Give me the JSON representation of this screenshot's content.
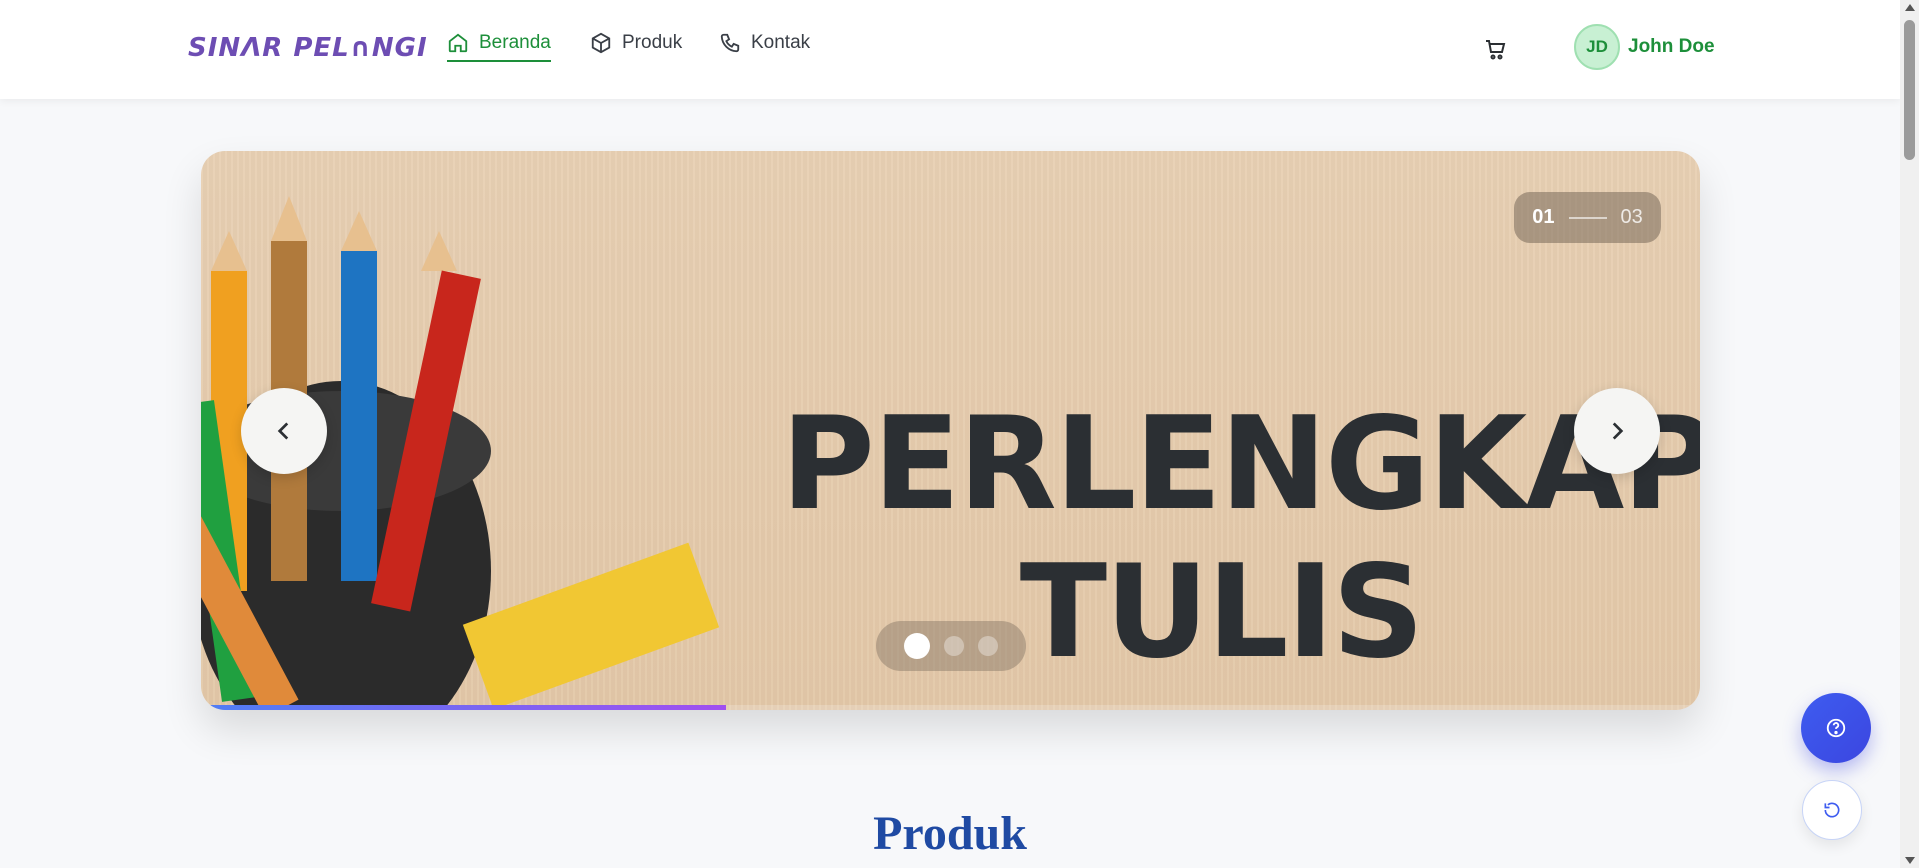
{
  "header": {
    "logo_text": "SINΛR PEL∩NGI",
    "nav": [
      {
        "label": "Beranda",
        "icon": "home-icon",
        "active": true
      },
      {
        "label": "Produk",
        "icon": "box-icon",
        "active": false
      },
      {
        "label": "Kontak",
        "icon": "phone-icon",
        "active": false
      }
    ],
    "cart_icon": "cart-icon",
    "user": {
      "initials": "JD",
      "name": "John Doe"
    }
  },
  "banner": {
    "title_line1": "PERLENGKAPAN",
    "title_line2": "TULIS",
    "counter_current": "01",
    "counter_total": "03",
    "slides_count": 3,
    "active_slide": 1,
    "progress_fraction": 0.35
  },
  "section": {
    "title": "Produk"
  },
  "colors": {
    "accent_green": "#1d8f3a",
    "title_blue": "#1f4aa3",
    "fab_blue": "#3e5cf0"
  }
}
